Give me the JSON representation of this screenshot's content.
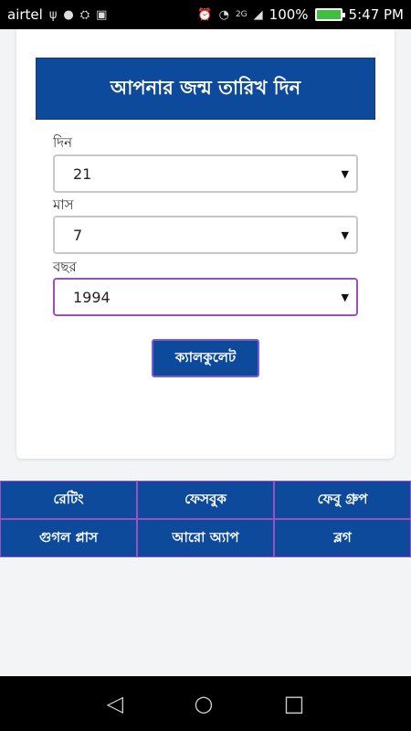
{
  "status_bar": {
    "carrier": "airtel",
    "battery": "100%",
    "time": "5:47 PM",
    "network": "2G"
  },
  "form": {
    "header": "আপনার জন্ম তারিখ দিন",
    "day_label": "দিন",
    "day_value": "21",
    "month_label": "মাস",
    "month_value": "7",
    "year_label": "বছর",
    "year_value": "1994",
    "calculate_label": "ক্যালকুলেট"
  },
  "bottom_menu": [
    "রেটিং",
    "ফেসবুক",
    "ফেবু গ্রুপ",
    "গুগল প্লাস",
    "আরো অ্যাপ",
    "ব্লগ"
  ],
  "colors": {
    "primary": "#0d4a9c",
    "border_accent": "#9c4fbf"
  }
}
